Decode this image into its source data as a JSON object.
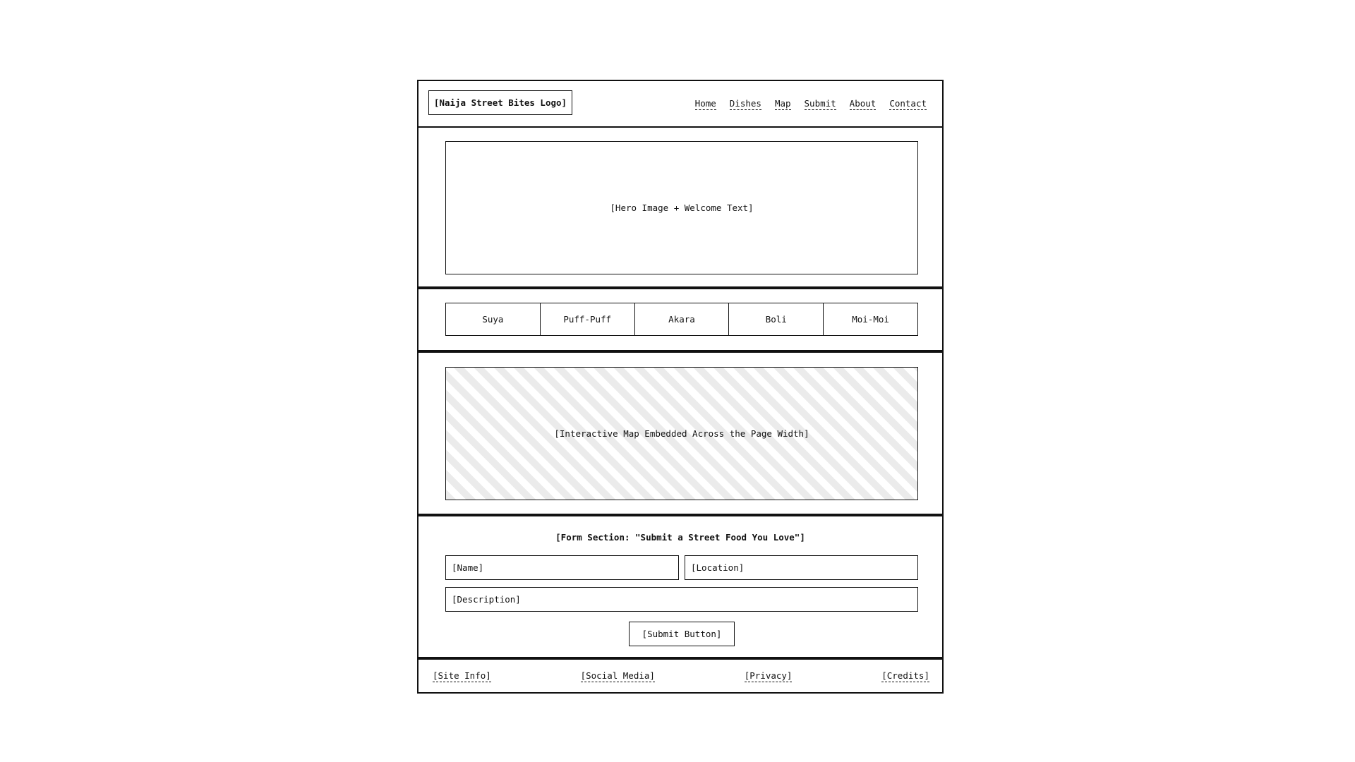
{
  "header": {
    "logo": "[Naija Street Bites Logo]",
    "nav": [
      "Home",
      "Dishes",
      "Map",
      "Submit",
      "About",
      "Contact"
    ]
  },
  "hero": {
    "placeholder": "[Hero Image + Welcome Text]"
  },
  "dishes": {
    "items": [
      "Suya",
      "Puff-Puff",
      "Akara",
      "Boli",
      "Moi-Moi"
    ]
  },
  "map": {
    "placeholder": "[Interactive Map Embedded Across the Page Width]"
  },
  "form": {
    "title": "[Form Section: \"Submit a Street Food You Love\"]",
    "name_placeholder": "[Name]",
    "location_placeholder": "[Location]",
    "description_placeholder": "[Description]",
    "submit_label": "[Submit Button]"
  },
  "footer": {
    "links": [
      "[Site Info]",
      "[Social Media]",
      "[Privacy]",
      "[Credits]"
    ]
  },
  "colors": {
    "border": "#111111",
    "map_stripe": "#ebebeb",
    "background": "#ffffff"
  }
}
